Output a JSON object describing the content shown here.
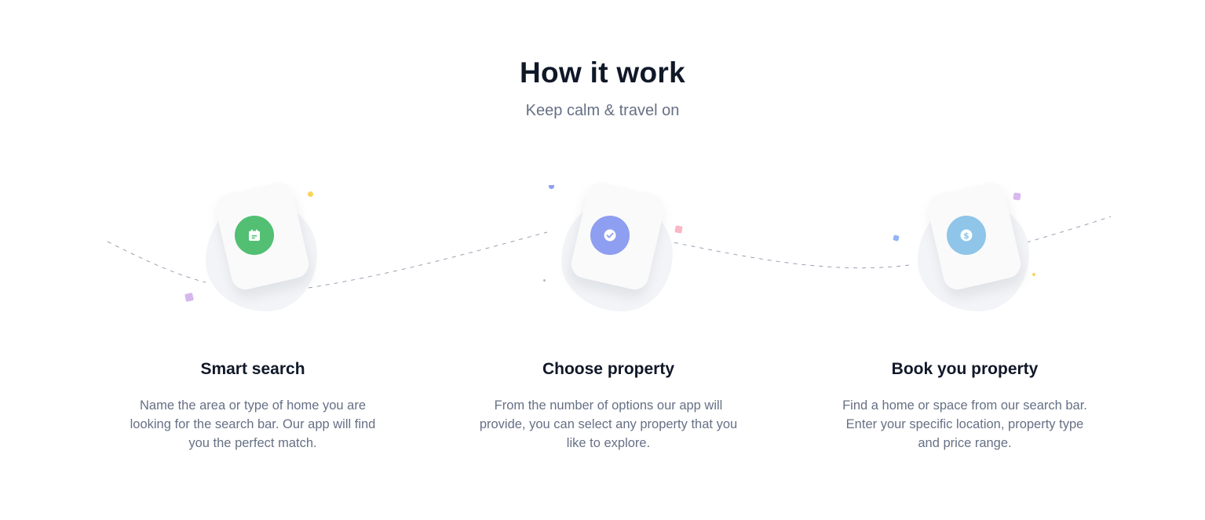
{
  "section": {
    "title": "How it work",
    "subtitle": "Keep calm & travel on"
  },
  "steps": [
    {
      "title": "Smart search",
      "description": "Name the area or type of home you are looking for the search bar. Our app will find you the perfect match.",
      "icon": "calendar-icon",
      "color": "#52bf72"
    },
    {
      "title": "Choose property",
      "description": "From the number of options our app will provide, you can select any property that you like to explore.",
      "icon": "check-icon",
      "color": "#8e9ef0"
    },
    {
      "title": "Book you property",
      "description": "Find a home or space from our search bar. Enter your specific location, property type and price range.",
      "icon": "dollar-icon",
      "color": "#8ec5e8"
    }
  ],
  "colors": {
    "heading": "#101828",
    "body": "#667085",
    "blob": "#f2f4f7",
    "connector": "#98a2b3"
  }
}
